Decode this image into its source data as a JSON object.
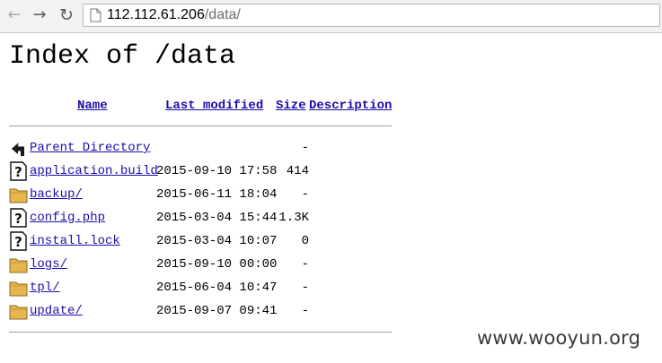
{
  "browser": {
    "back_icon": "arrow-left-icon",
    "forward_icon": "arrow-right-icon",
    "reload_icon": "reload-icon",
    "url_host": "112.112.61.206",
    "url_path": "/data/"
  },
  "page": {
    "title": "Index of /data"
  },
  "table": {
    "headers": {
      "name": "Name",
      "last_modified": "Last modified",
      "size": "Size",
      "description": "Description"
    },
    "rows": [
      {
        "icon": "parent-directory-icon",
        "name": "Parent Directory",
        "modified": "",
        "size": "-"
      },
      {
        "icon": "unknown-file-icon",
        "name": "application.build",
        "modified": "2015-09-10 17:58",
        "size": "414"
      },
      {
        "icon": "folder-icon",
        "name": "backup/",
        "modified": "2015-06-11 18:04",
        "size": "-"
      },
      {
        "icon": "unknown-file-icon",
        "name": "config.php",
        "modified": "2015-03-04 15:44",
        "size": "1.3K"
      },
      {
        "icon": "unknown-file-icon",
        "name": "install.lock",
        "modified": "2015-03-04 10:07",
        "size": "0"
      },
      {
        "icon": "folder-icon",
        "name": "logs/",
        "modified": "2015-09-10 00:00",
        "size": "-"
      },
      {
        "icon": "folder-icon",
        "name": "tpl/",
        "modified": "2015-06-04 10:47",
        "size": "-"
      },
      {
        "icon": "folder-icon",
        "name": "update/",
        "modified": "2015-09-07 09:41",
        "size": "-"
      }
    ]
  },
  "watermark": "www.wooyun.org",
  "colors": {
    "link": "#1a0dab",
    "folder": "#e8b650",
    "rule": "#a0a0a0"
  }
}
